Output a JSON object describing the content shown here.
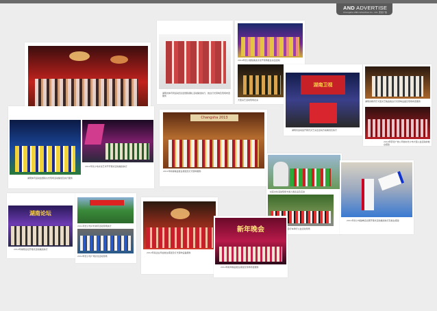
{
  "brand": {
    "name_bold": "AND",
    "name_rest": "ADVERTISE",
    "sub": "Changsha AND Advertise Co., Ltd. 安德广告"
  },
  "captions": {
    "c1": "湖南卫视节目现场活动策划执行及舞台搭建与灯光音响设备租赁服务",
    "c2": "湖南省体育局运动员表彰颁奖典礼活动策划执行，舞台灯光音响及现场布置服务",
    "c3": "大型演艺活动现场表演",
    "c4": "2010年长沙湘菜美食文化节现场舞台演出活动",
    "c5": "湖南省运动会开幕式文艺演出活动方案策划及执行",
    "c6": "湖南省教育厅大型文艺晚会舞台灯光音响设备及现场布置服务",
    "c7": "2010年安德广告公司协办长沙市大型公益活动的舞台搭建",
    "c8": "湖南体育运动会颁奖仪式现场活动策划及执行服务",
    "c9": "2011年长沙市文化艺术节开幕式活动策划执行",
    "c10": "2011年新春晚会舞台搭建及灯光音响服务",
    "c11": "社区文化活动现场卡通人偶表演及互动",
    "c12": "2010年长沙市大型自行车骑行公益活动现场",
    "c13": "2011年长沙市跆拳道比赛开幕式活动策划执行及舞台搭建",
    "c14": "2012年湖南论坛开幕式活动策划执行",
    "c15": "2011年长沙市户外体育活动现场执行",
    "c16": "2012年长沙市广场文化活动现场",
    "c17": "2012年某企业年会舞台搭建及灯光音响设备服务",
    "c18": "2012年新年晚会舞台搭建及现场布置服务"
  },
  "banners": {
    "b1": "湖南卫视",
    "b2": "Changsha 2013",
    "b3": "新年晚会",
    "b4": "湖南论坛"
  }
}
